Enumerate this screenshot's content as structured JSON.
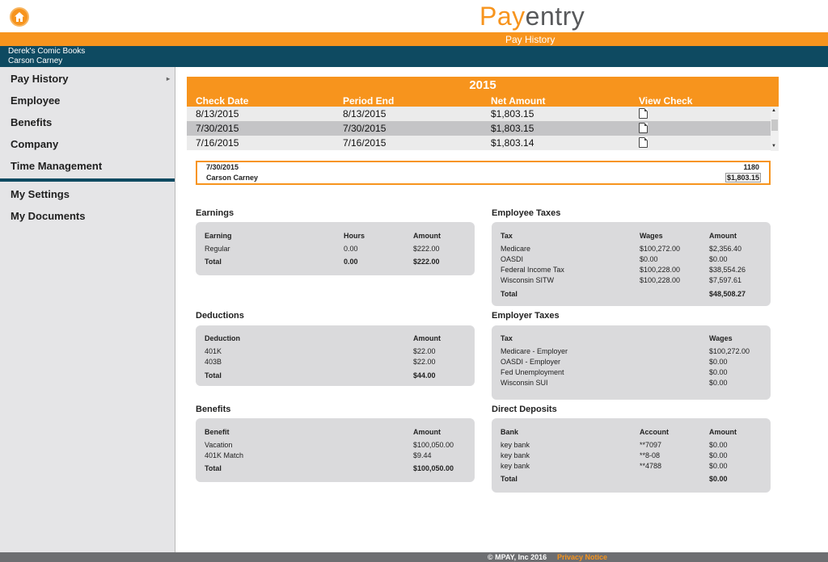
{
  "app": {
    "logo_part1": "Pay",
    "logo_part2": "entry",
    "page_title": "Pay History",
    "company": "Derek's Comic Books",
    "employee": "Carson Carney",
    "accent": "#f7941d",
    "brand_blue": "#0e4a61"
  },
  "sidebar": {
    "items": [
      {
        "label": "Pay History"
      },
      {
        "label": "Employee"
      },
      {
        "label": "Benefits"
      },
      {
        "label": "Company"
      },
      {
        "label": "Time Management"
      }
    ],
    "items2": [
      {
        "label": "My Settings"
      },
      {
        "label": "My Documents"
      }
    ]
  },
  "pay_table": {
    "year": "2015",
    "headers": {
      "check_date": "Check Date",
      "period_end": "Period End",
      "net_amount": "Net Amount",
      "view_check": "View Check"
    },
    "rows": [
      {
        "check_date": "8/13/2015",
        "period_end": "8/13/2015",
        "net": "$1,803.15"
      },
      {
        "check_date": "7/30/2015",
        "period_end": "7/30/2015",
        "net": "$1,803.15"
      },
      {
        "check_date": "7/16/2015",
        "period_end": "7/16/2015",
        "net": "$1,803.14"
      }
    ]
  },
  "check_summary": {
    "date": "7/30/2015",
    "number": "1180",
    "name": "Carson Carney",
    "amount": "$1,803.15"
  },
  "earnings": {
    "title": "Earnings",
    "headers": [
      "Earning",
      "Hours",
      "Amount"
    ],
    "rows": [
      {
        "name": "Regular",
        "hours": "0.00",
        "amount": "$222.00"
      }
    ],
    "total": {
      "label": "Total",
      "hours": "0.00",
      "amount": "$222.00"
    }
  },
  "deductions": {
    "title": "Deductions",
    "headers": [
      "Deduction",
      "Amount"
    ],
    "rows": [
      {
        "name": "401K",
        "amount": "$22.00"
      },
      {
        "name": "403B",
        "amount": "$22.00"
      }
    ],
    "total": {
      "label": "Total",
      "amount": "$44.00"
    }
  },
  "benefits": {
    "title": "Benefits",
    "headers": [
      "Benefit",
      "Amount"
    ],
    "rows": [
      {
        "name": "Vacation",
        "amount": "$100,050.00"
      },
      {
        "name": "401K Match",
        "amount": "$9.44"
      }
    ],
    "total": {
      "label": "Total",
      "amount": "$100,050.00"
    }
  },
  "employee_taxes": {
    "title": "Employee Taxes",
    "headers": [
      "Tax",
      "Wages",
      "Amount"
    ],
    "rows": [
      {
        "name": "Medicare",
        "wages": "$100,272.00",
        "amount": "$2,356.40"
      },
      {
        "name": "OASDI",
        "wages": "$0.00",
        "amount": "$0.00"
      },
      {
        "name": "Federal Income Tax",
        "wages": "$100,228.00",
        "amount": "$38,554.26"
      },
      {
        "name": "Wisconsin SITW",
        "wages": "$100,228.00",
        "amount": "$7,597.61"
      }
    ],
    "total": {
      "label": "Total",
      "amount": "$48,508.27"
    }
  },
  "employer_taxes": {
    "title": "Employer Taxes",
    "headers": [
      "Tax",
      "Wages"
    ],
    "rows": [
      {
        "name": "Medicare - Employer",
        "wages": "$100,272.00"
      },
      {
        "name": "OASDI - Employer",
        "wages": "$0.00"
      },
      {
        "name": "Fed Unemployment",
        "wages": "$0.00"
      },
      {
        "name": "Wisconsin SUI",
        "wages": "$0.00"
      }
    ]
  },
  "direct_deposits": {
    "title": "Direct Deposits",
    "headers": [
      "Bank",
      "Account",
      "Amount"
    ],
    "rows": [
      {
        "bank": "key bank",
        "account": "**7097",
        "amount": "$0.00"
      },
      {
        "bank": "key bank",
        "account": "**8-08",
        "amount": "$0.00"
      },
      {
        "bank": "key bank",
        "account": "**4788",
        "amount": "$0.00"
      }
    ],
    "total": {
      "label": "Total",
      "amount": "$0.00"
    }
  },
  "footer": {
    "copyright": "© MPAY, Inc 2016",
    "privacy": "Privacy Notice"
  }
}
